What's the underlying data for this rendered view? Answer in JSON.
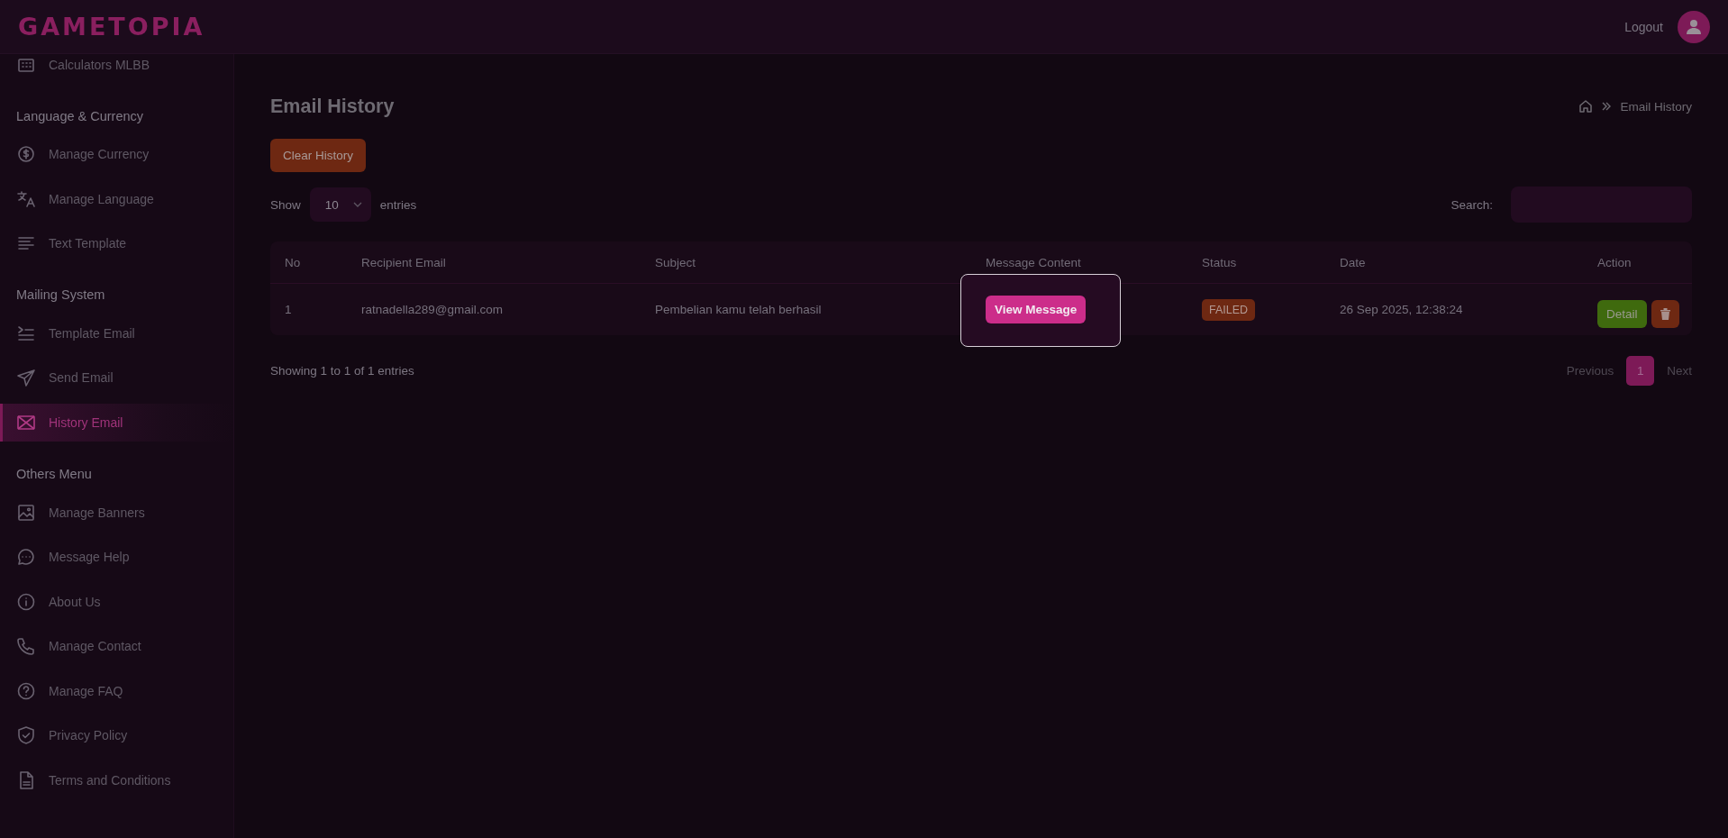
{
  "header": {
    "logo": "GAMETOPIA",
    "logout": "Logout"
  },
  "sidebar": {
    "sections": [
      {
        "items": [
          {
            "label": "Calculators MLBB",
            "selected": false
          }
        ]
      },
      {
        "heading": "Language & Currency",
        "items": [
          {
            "label": "Manage Currency",
            "selected": false
          },
          {
            "label": "Manage Language",
            "selected": false
          },
          {
            "label": "Text Template",
            "selected": false
          }
        ]
      },
      {
        "heading": "Mailing System",
        "items": [
          {
            "label": "Template Email",
            "selected": false
          },
          {
            "label": "Send Email",
            "selected": false
          },
          {
            "label": "History Email",
            "selected": true
          }
        ]
      },
      {
        "heading": "Others Menu",
        "items": [
          {
            "label": "Manage Banners",
            "selected": false
          },
          {
            "label": "Message Help",
            "selected": false
          },
          {
            "label": "About Us",
            "selected": false
          },
          {
            "label": "Manage Contact",
            "selected": false
          },
          {
            "label": "Manage FAQ",
            "selected": false
          },
          {
            "label": "Privacy Policy",
            "selected": false
          },
          {
            "label": "Terms and Conditions",
            "selected": false
          }
        ]
      }
    ]
  },
  "page": {
    "title": "Email History",
    "breadcrumb": "Email History",
    "clear_button": "Clear History",
    "show_label": "Show",
    "page_size": "10",
    "entries_label": "entries",
    "search_label": "Search:"
  },
  "table": {
    "columns": [
      "No",
      "Recipient Email",
      "Subject",
      "Message Content",
      "Status",
      "Date",
      "Action"
    ],
    "rows": [
      {
        "no": "1",
        "email": "ratnadella289@gmail.com",
        "subject": "Pembelian kamu telah berhasil",
        "message_button": "View Message",
        "message_highlighted": true,
        "status": {
          "label": "FAILED",
          "kind": "failed"
        },
        "date": "26 Sep 2025, 12:38:24",
        "detail_button": "Detail"
      }
    ]
  },
  "footer": {
    "info": "Showing 1 to 1 of 1 entries",
    "previous": "Previous",
    "pages": [
      {
        "label": "1",
        "selected": true
      }
    ],
    "next": "Next"
  }
}
